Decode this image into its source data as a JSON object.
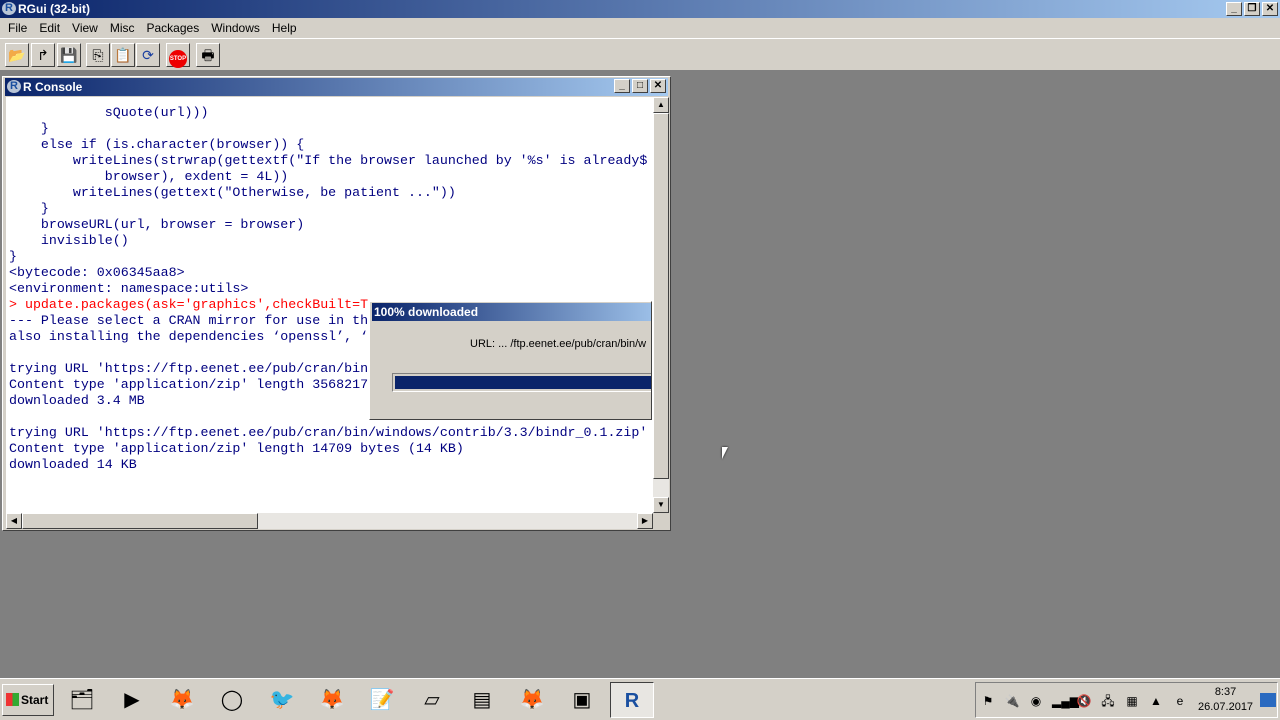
{
  "app": {
    "title": "RGui (32-bit)"
  },
  "menu": [
    "File",
    "Edit",
    "View",
    "Misc",
    "Packages",
    "Windows",
    "Help"
  ],
  "toolbar": [
    {
      "icon": "open-folder-icon"
    },
    {
      "icon": "load-workspace-icon"
    },
    {
      "icon": "save-icon"
    },
    {
      "icon": "copy-icon"
    },
    {
      "icon": "paste-icon"
    },
    {
      "icon": "refresh-icon"
    },
    {
      "icon": "stop-icon",
      "label": "STOP"
    },
    {
      "icon": "print-icon"
    }
  ],
  "console": {
    "title": "R Console",
    "lines": [
      {
        "t": "            sQuote(url)))",
        "c": "out"
      },
      {
        "t": "    }",
        "c": "out"
      },
      {
        "t": "    else if (is.character(browser)) {",
        "c": "out"
      },
      {
        "t": "        writeLines(strwrap(gettextf(\"If the browser launched by '%s' is already$",
        "c": "out"
      },
      {
        "t": "            browser), exdent = 4L))",
        "c": "out"
      },
      {
        "t": "        writeLines(gettext(\"Otherwise, be patient ...\"))",
        "c": "out"
      },
      {
        "t": "    }",
        "c": "out"
      },
      {
        "t": "    browseURL(url, browser = browser)",
        "c": "out"
      },
      {
        "t": "    invisible()",
        "c": "out"
      },
      {
        "t": "}",
        "c": "out"
      },
      {
        "t": "<bytecode: 0x06345aa8>",
        "c": "out"
      },
      {
        "t": "<environment: namespace:utils>",
        "c": "out"
      },
      {
        "t": "> update.packages(ask='graphics',checkBuilt=T",
        "c": "in"
      },
      {
        "t": "--- Please select a CRAN mirror for use in th",
        "c": "out"
      },
      {
        "t": "also installing the dependencies ‘openssl’, ‘",
        "c": "out"
      },
      {
        "t": "",
        "c": "out"
      },
      {
        "t": "trying URL 'https://ftp.eenet.ee/pub/cran/bin",
        "c": "out"
      },
      {
        "t": "Content type 'application/zip' length 3568217",
        "c": "out"
      },
      {
        "t": "downloaded 3.4 MB",
        "c": "out"
      },
      {
        "t": "",
        "c": "out"
      },
      {
        "t": "trying URL 'https://ftp.eenet.ee/pub/cran/bin/windows/contrib/3.3/bindr_0.1.zip'",
        "c": "out"
      },
      {
        "t": "Content type 'application/zip' length 14709 bytes (14 KB)",
        "c": "out"
      },
      {
        "t": "downloaded 14 KB",
        "c": "out"
      }
    ]
  },
  "dialog": {
    "title": "100% downloaded",
    "url": "URL: ... /ftp.eenet.ee/pub/cran/bin/w",
    "progress": 1.0
  },
  "taskbar": {
    "start": "Start",
    "apps": [
      "explorer",
      "media-player",
      "firefox",
      "opera",
      "thunderbird",
      "firefox",
      "notepad-plus",
      "eraser",
      "window-app",
      "firefox",
      "terminal",
      "R"
    ],
    "active": "R"
  },
  "tray": {
    "time": "8:37",
    "date": "26.07.2017",
    "icons": [
      "action-center-error",
      "power",
      "sync",
      "signal",
      "volume-muted",
      "usb-ok",
      "monitor-app",
      "cpu-graph",
      "eset-warning"
    ]
  }
}
